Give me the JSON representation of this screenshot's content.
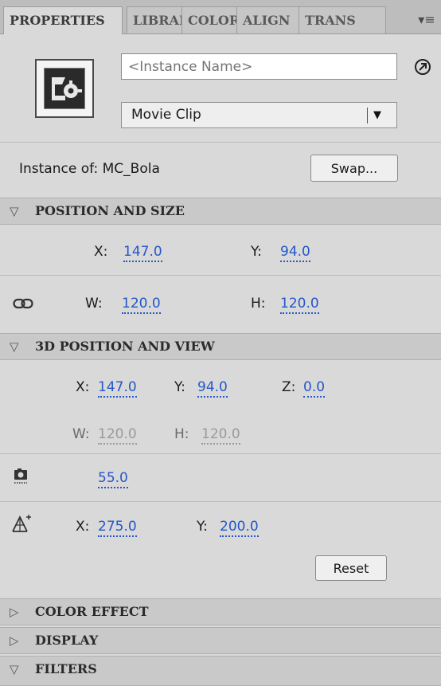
{
  "tabs": [
    "PROPERTIES",
    "LIBRAI",
    "COLOR",
    "ALIGN",
    "TRANS"
  ],
  "instance_name": {
    "placeholder": "<Instance Name>",
    "value": ""
  },
  "symbol_type": "Movie Clip",
  "instance_of": "Instance of: MC_Bola",
  "swap_label": "Swap...",
  "sections": {
    "position_size": "POSITION AND SIZE",
    "position_3d": "3D POSITION AND VIEW",
    "color_effect": "COLOR EFFECT",
    "display": "DISPLAY",
    "filters": "FILTERS"
  },
  "position_size": {
    "x_label": "X:",
    "x": "147.0",
    "y_label": "Y:",
    "y": "94.0",
    "w_label": "W:",
    "w": "120.0",
    "h_label": "H:",
    "h": "120.0"
  },
  "position_3d": {
    "x_label": "X:",
    "x": "147.0",
    "y_label": "Y:",
    "y": "94.0",
    "z_label": "Z:",
    "z": "0.0",
    "w_label": "W:",
    "w": "120.0",
    "h_label": "H:",
    "h": "120.0",
    "perspective_angle": "55.0",
    "vp_x_label": "X:",
    "vp_x": "275.0",
    "vp_y_label": "Y:",
    "vp_y": "200.0",
    "reset_label": "Reset"
  },
  "icons": {
    "menu": "panel-menu-icon",
    "go": "edit-symbol-icon",
    "link": "lock-width-height-icon",
    "camera": "perspective-angle-icon",
    "vanishing": "vanishing-point-icon"
  },
  "colors": {
    "link": "#2457c8",
    "panel_bg": "#d9d9d9",
    "section_bg": "#c9c9c9"
  }
}
